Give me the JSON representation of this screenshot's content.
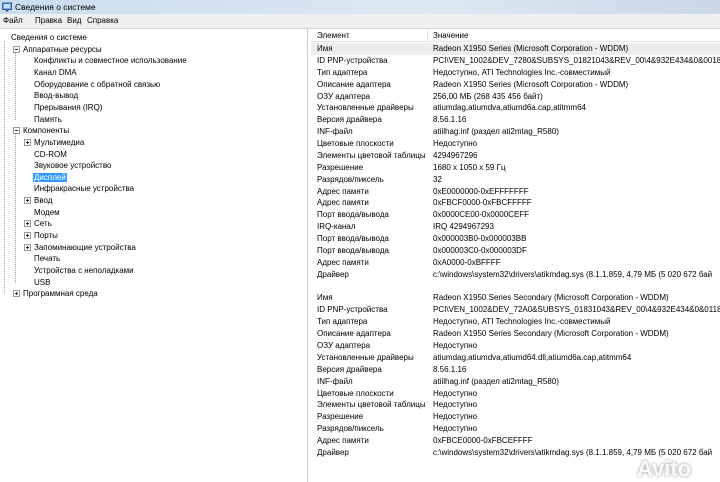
{
  "window": {
    "title": "Сведения о системе"
  },
  "menu": [
    "Файл",
    "Правка",
    "Вид",
    "Справка"
  ],
  "tree": [
    {
      "label": "Сведения о системе",
      "level": 0,
      "expander": null
    },
    {
      "label": "Аппаратные ресурсы",
      "level": 1,
      "expander": "minus"
    },
    {
      "label": "Конфликты и совместное использование",
      "level": 2,
      "expander": null
    },
    {
      "label": "Канал DMA",
      "level": 2,
      "expander": null
    },
    {
      "label": "Оборудование с обратной связью",
      "level": 2,
      "expander": null
    },
    {
      "label": "Ввод-вывод",
      "level": 2,
      "expander": null
    },
    {
      "label": "Прерывания (IRQ)",
      "level": 2,
      "expander": null
    },
    {
      "label": "Память",
      "level": 2,
      "expander": null
    },
    {
      "label": "Компоненты",
      "level": 1,
      "expander": "minus"
    },
    {
      "label": "Мультимедиа",
      "level": 2,
      "expander": "plus"
    },
    {
      "label": "CD-ROM",
      "level": 2,
      "expander": null
    },
    {
      "label": "Звуковое устройство",
      "level": 2,
      "expander": null
    },
    {
      "label": "Дисплей",
      "level": 2,
      "expander": null,
      "selected": true
    },
    {
      "label": "Инфракрасные устройства",
      "level": 2,
      "expander": null
    },
    {
      "label": "Ввод",
      "level": 2,
      "expander": "plus"
    },
    {
      "label": "Модем",
      "level": 2,
      "expander": null
    },
    {
      "label": "Сеть",
      "level": 2,
      "expander": "plus"
    },
    {
      "label": "Порты",
      "level": 2,
      "expander": "plus"
    },
    {
      "label": "Запоминающие устройства",
      "level": 2,
      "expander": "plus"
    },
    {
      "label": "Печать",
      "level": 2,
      "expander": null
    },
    {
      "label": "Устройства с неполадками",
      "level": 2,
      "expander": null
    },
    {
      "label": "USB",
      "level": 2,
      "expander": null
    },
    {
      "label": "Программная среда",
      "level": 1,
      "expander": "plus"
    }
  ],
  "details": {
    "columns": [
      "Элемент",
      "Значение"
    ],
    "groups": [
      [
        [
          "Имя",
          "Radeon X1950 Series (Microsoft Corporation - WDDM)"
        ],
        [
          "ID PNP-устройства",
          "PCI\\VEN_1002&DEV_7280&SUBSYS_01821043&REV_00\\4&932E434&0&0018"
        ],
        [
          "Тип адаптера",
          "Недоступно, ATI Technologies Inc.-совместимый"
        ],
        [
          "Описание адаптера",
          "Radeon X1950 Series (Microsoft Corporation - WDDM)"
        ],
        [
          "ОЗУ адаптера",
          "256,00 МБ (268 435 456 байт)"
        ],
        [
          "Установленные драйверы",
          "atiumdag,atiumdva,atiumd6a.cap,atitmm64"
        ],
        [
          "Версия драйвера",
          "8.56.1.16"
        ],
        [
          "INF-файл",
          "atiilhag.inf (раздел ati2mtag_R580)"
        ],
        [
          "Цветовые плоскости",
          "Недоступно"
        ],
        [
          "Элементы цветовой таблицы",
          "4294967296"
        ],
        [
          "Разрешение",
          "1680 x 1050 x 59 Гц"
        ],
        [
          "Разрядов/пиксель",
          "32"
        ],
        [
          "Адрес памяти",
          "0xE0000000-0xEFFFFFFF"
        ],
        [
          "Адрес памяти",
          "0xFBCF0000-0xFBCFFFFF"
        ],
        [
          "Порт ввода/вывода",
          "0x0000CE00-0x0000CEFF"
        ],
        [
          "IRQ-канал",
          "IRQ 4294967293"
        ],
        [
          "Порт ввода/вывода",
          "0x000003B0-0x000003BB"
        ],
        [
          "Порт ввода/вывода",
          "0x000003C0-0x000003DF"
        ],
        [
          "Адрес памяти",
          "0xA0000-0xBFFFF"
        ],
        [
          "Драйвер",
          "c:\\windows\\system32\\drivers\\atikmdag.sys (8.1.1.859, 4,79 МБ (5 020 672 бай"
        ]
      ],
      [
        [
          "Имя",
          "Radeon X1950 Series Secondary (Microsoft Corporation - WDDM)"
        ],
        [
          "ID PNP-устройства",
          "PCI\\VEN_1002&DEV_72A0&SUBSYS_01831043&REV_00\\4&932E434&0&0118"
        ],
        [
          "Тип адаптера",
          "Недоступно, ATI Technologies Inc.-совместимый"
        ],
        [
          "Описание адаптера",
          "Radeon X1950 Series Secondary (Microsoft Corporation - WDDM)"
        ],
        [
          "ОЗУ адаптера",
          "Недоступно"
        ],
        [
          "Установленные драйверы",
          "atiumdag,atiumdva,atiumd64.dll,atiumd6a.cap,atitmm64"
        ],
        [
          "Версия драйвера",
          "8.56.1.16"
        ],
        [
          "INF-файл",
          "atiilhag.inf (раздел ati2mtag_R580)"
        ],
        [
          "Цветовые плоскости",
          "Недоступно"
        ],
        [
          "Элементы цветовой таблицы",
          "Недоступно"
        ],
        [
          "Разрешение",
          "Недоступно"
        ],
        [
          "Разрядов/пиксель",
          "Недоступно"
        ],
        [
          "Адрес памяти",
          "0xFBCE0000-0xFBCEFFFF"
        ],
        [
          "Драйвер",
          "c:\\windows\\system32\\drivers\\atikmdag.sys (8.1.1.859, 4,79 МБ (5 020 672 бай"
        ]
      ]
    ]
  },
  "watermark": {
    "text": "Avito"
  }
}
